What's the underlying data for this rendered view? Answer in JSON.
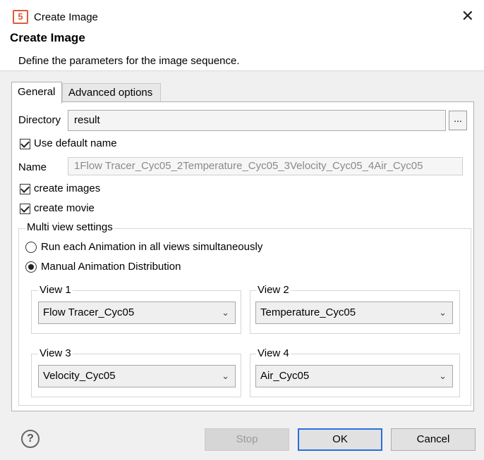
{
  "window": {
    "title": "Create Image",
    "app_icon_text": "5"
  },
  "header": {
    "heading": "Create Image",
    "description": "Define the parameters for the image sequence."
  },
  "tabs": [
    {
      "label": "General",
      "active": true
    },
    {
      "label": "Advanced options",
      "active": false
    }
  ],
  "general": {
    "directory_label": "Directory",
    "directory_value": "result",
    "browse_label": "...",
    "use_default_name_label": "Use default name",
    "use_default_name_checked": true,
    "name_label": "Name",
    "name_value": "1Flow Tracer_Cyc05_2Temperature_Cyc05_3Velocity_Cyc05_4Air_Cyc05",
    "create_images_label": "create images",
    "create_images_checked": true,
    "create_movie_label": "create movie",
    "create_movie_checked": true
  },
  "multi_view": {
    "legend": "Multi view settings",
    "option_simultaneous": "Run each Animation in all views simultaneously",
    "option_manual": "Manual Animation Distribution",
    "selected": "manual",
    "views": [
      {
        "label": "View 1",
        "value": "Flow Tracer_Cyc05"
      },
      {
        "label": "View 2",
        "value": "Temperature_Cyc05"
      },
      {
        "label": "View 3",
        "value": "Velocity_Cyc05"
      },
      {
        "label": "View 4",
        "value": "Air_Cyc05"
      }
    ]
  },
  "footer": {
    "help_glyph": "?",
    "stop_label": "Stop",
    "ok_label": "OK",
    "cancel_label": "Cancel"
  },
  "colors": {
    "accent": "#2a6fdb",
    "app_icon": "#e05a3a"
  }
}
